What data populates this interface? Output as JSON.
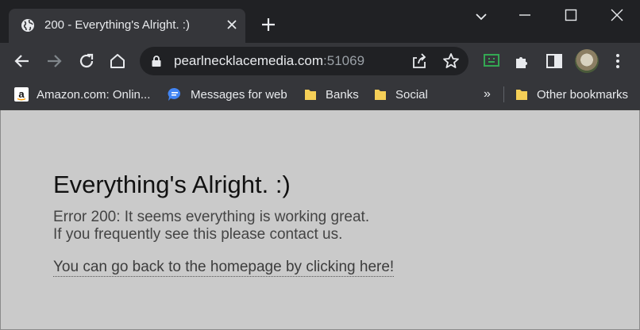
{
  "tab": {
    "title": "200 - Everything's Alright. :)"
  },
  "toolbar": {
    "url_host": "pearlnecklacemedia.com",
    "url_port": ":51069"
  },
  "bookmarks": {
    "items": [
      {
        "label": "Amazon.com: Onlin...",
        "icon": "amazon-icon"
      },
      {
        "label": "Messages for web",
        "icon": "messages-icon"
      },
      {
        "label": "Banks",
        "icon": "folder-icon"
      },
      {
        "label": "Social",
        "icon": "folder-icon"
      }
    ],
    "overflow": "»",
    "other": "Other bookmarks"
  },
  "page": {
    "heading": "Everything's Alright. :)",
    "line1": "Error 200: It seems everything is working great.",
    "line2": "If you frequently see this please contact us.",
    "link": "You can go back to the homepage by clicking here!"
  },
  "colors": {
    "chrome_dark": "#202124",
    "chrome_toolbar": "#35363a",
    "page_background": "#cacaca",
    "folder_yellow": "#f5cf57"
  }
}
